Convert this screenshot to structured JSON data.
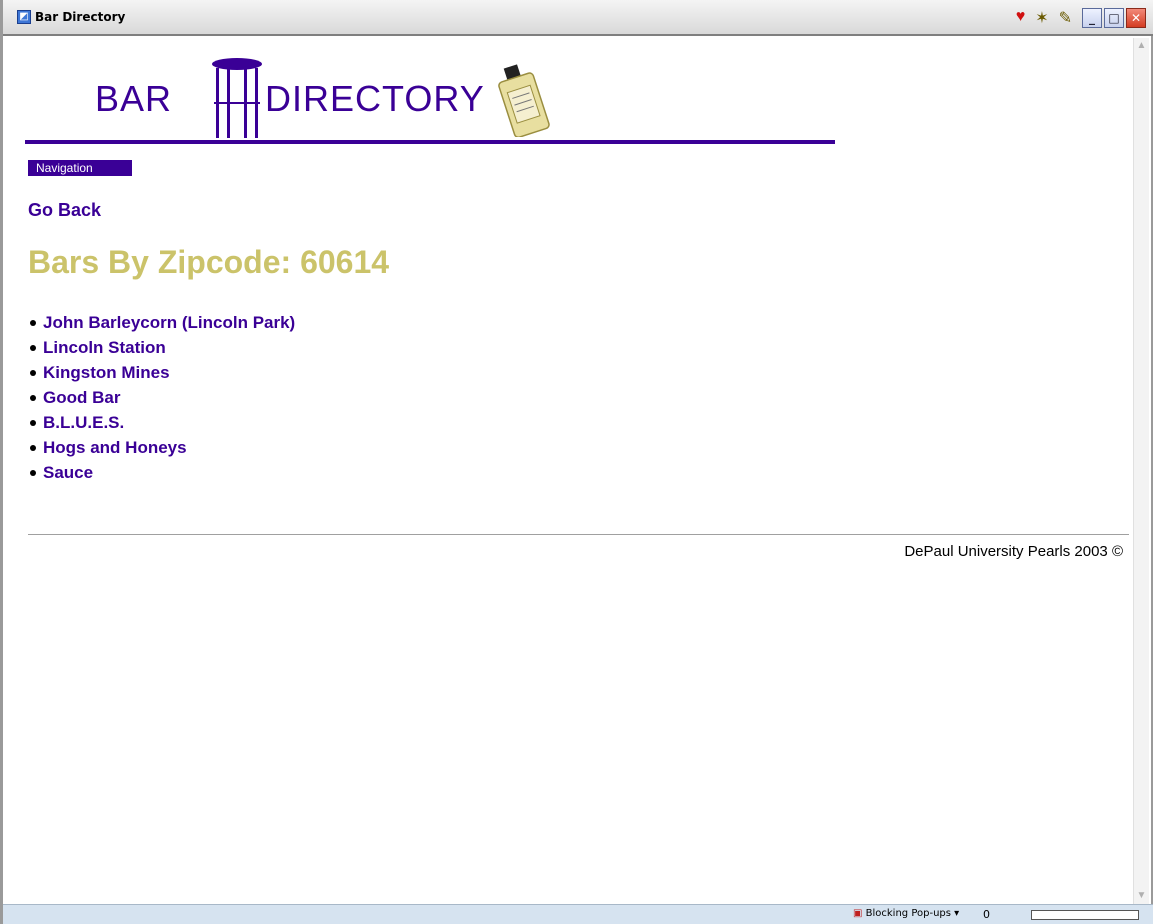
{
  "window": {
    "title": "Bar Directory"
  },
  "banner": {
    "word1": "BAR",
    "word2": "DIRECTORY",
    "brand_color": "#3a0096"
  },
  "nav": {
    "label": "Navigation"
  },
  "links": {
    "go_back": "Go Back"
  },
  "page": {
    "title": "Bars By Zipcode: 60614",
    "title_color": "#cbc36a"
  },
  "bars": [
    {
      "name": "John Barleycorn (Lincoln Park)"
    },
    {
      "name": "Lincoln Station"
    },
    {
      "name": "Kingston Mines"
    },
    {
      "name": "Good Bar"
    },
    {
      "name": "B.L.U.E.S."
    },
    {
      "name": "Hogs and Honeys"
    },
    {
      "name": "Sauce"
    }
  ],
  "footer": {
    "text": "DePaul University Pearls 2003 ©"
  },
  "statusbar": {
    "popup_label": "Blocking Pop-ups ▾",
    "count": "0"
  }
}
